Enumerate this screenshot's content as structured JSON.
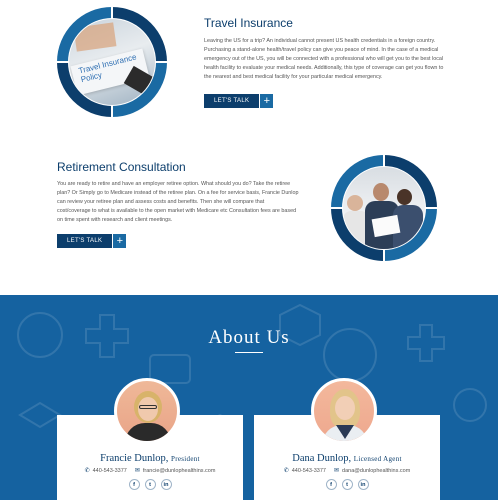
{
  "colors": {
    "navy": "#0c3e6c",
    "blue": "#1562a0",
    "accent": "#1a6aa3"
  },
  "travel": {
    "title": "Travel Insurance",
    "photo_caption": "Travel Insurance Policy",
    "body": "Leaving the US for a trip? An individual cannot present US health credentials in a foreign country. Purchasing a stand-alone health/travel policy can give you peace of mind. In the case of a medical emergency out of the US, you will be connected with a professional who will get you to the best local health facility to evaluate your medical needs. Additionally, this type of coverage can get you flown to the nearest and best medical facility for your particular medical emergency.",
    "cta_label": "LET'S TALK",
    "cta_icon": "plus-icon"
  },
  "retirement": {
    "title": "Retirement Consultation",
    "body": "You are ready to retire and have an employer retiree option. What should you do? Take the retiree plan? Or Simply go to Medicare instead of the retiree plan. On a fee for service basis, Francie Dunlop can review your retiree plan and assess costs and benefits. Then she will compare that cost/coverage to what is available to the open market with Medicare etc Consultation fees are based on time spent with research and client meetings.",
    "cta_label": "LET'S TALK",
    "cta_icon": "plus-icon"
  },
  "about": {
    "title": "About Us",
    "team": [
      {
        "name": "Francie Dunlop,",
        "role": "President",
        "phone": "440-543-3377",
        "email": "francie@dunlophealthins.com",
        "social": [
          "f",
          "t",
          "in"
        ]
      },
      {
        "name": "Dana Dunlop,",
        "role": "Licensed Agent",
        "phone": "440-543-3377",
        "email": "dana@dunlophealthins.com",
        "social": [
          "f",
          "t",
          "in"
        ]
      }
    ]
  }
}
